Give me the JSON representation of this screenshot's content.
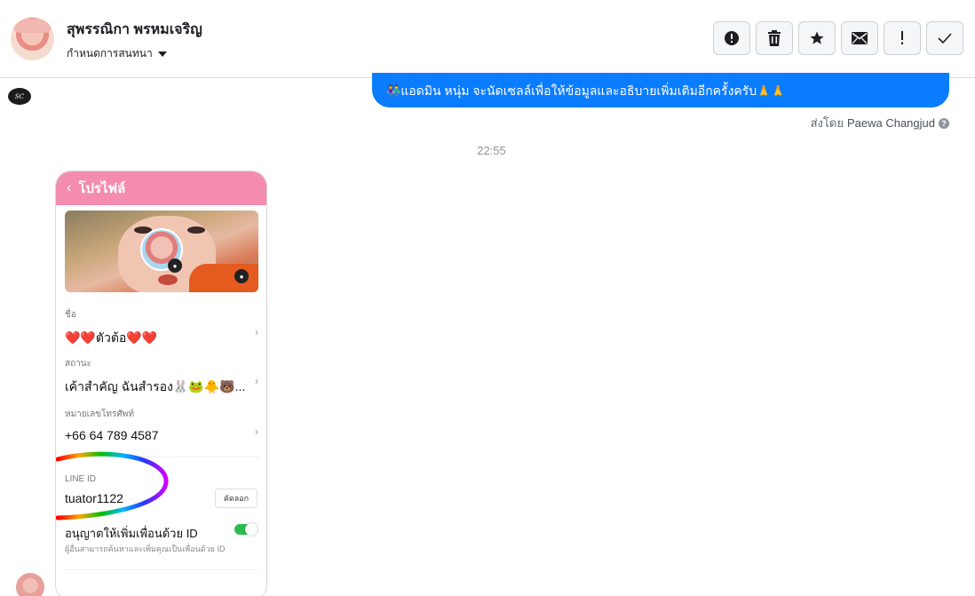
{
  "header": {
    "contact_name": "สุพรรณิกา พรหมเจริญ",
    "assign_label": "กำหนดการสนทนา",
    "actions": [
      {
        "name": "spam-button",
        "icon": "alert-circle-icon"
      },
      {
        "name": "delete-button",
        "icon": "trash-icon"
      },
      {
        "name": "star-button",
        "icon": "star-icon"
      },
      {
        "name": "mark-unread-button",
        "icon": "envelope-icon"
      },
      {
        "name": "follow-up-button",
        "icon": "exclamation-icon"
      },
      {
        "name": "mark-done-button",
        "icon": "check-icon"
      }
    ]
  },
  "conversation": {
    "outgoing_message": "แอดมิน หนุ่ม จะนัดเซลล์เพื่อให้ข้อมูลและอธิบายเพิ่มเติมอีกครั้งครับ",
    "outgoing_prefix_emoji": "👫",
    "outgoing_suffix_emoji": "🙏🙏",
    "sent_by_label": "ส่งโดย",
    "sent_by_agent": "Paewa Changjud",
    "timestamp": "22:55"
  },
  "attachment": {
    "header_title": "โปรไฟล์",
    "name_label": "ชื่อ",
    "name_value": "❤️❤️ตัวต้อ❤️❤️",
    "status_label": "สถานะ",
    "status_value": "เค้าสำคัญ ฉันสำรอง🐰🐸🐥🐻...",
    "phone_label": "หมายเลขโทรศัพท์",
    "phone_value": "+66 64 789 4587",
    "line_id_label": "LINE ID",
    "line_id_value": "tuator1122",
    "copy_label": "คัดลอก",
    "allow_label": "อนุญาตให้เพิ่มเพื่อนด้วย ID",
    "allow_sub": "ผู้อื่นสามารถค้นหาและเพิ่มคุณเป็นเพื่อนด้วย ID",
    "allow_enabled": true
  },
  "colors": {
    "outgoing_bubble": "#0a7cff",
    "line_header": "#f48cb0",
    "toggle_on": "#2bbd4d"
  }
}
